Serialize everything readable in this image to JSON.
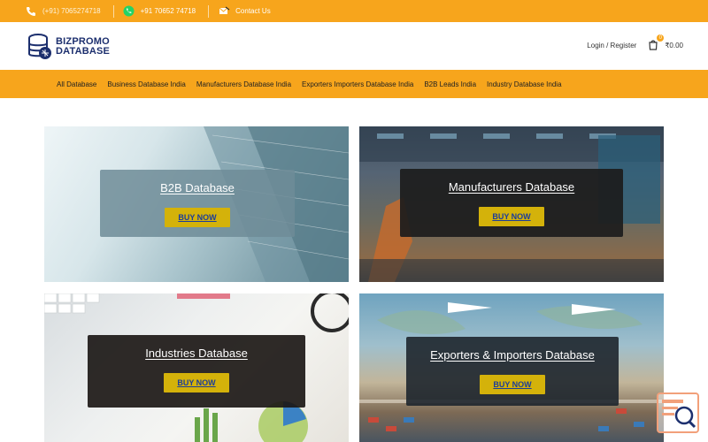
{
  "topbar": {
    "phone1": "(+91) 7065274718",
    "whatsapp": "+91 70652 74718",
    "contact": "Contact Us"
  },
  "header": {
    "logo_line1": "BIZPROMO",
    "logo_line2": "DATABASE",
    "login_register": "Login / Register",
    "cart_count": "0",
    "cart_total": "₹0.00"
  },
  "nav": {
    "items": [
      "All Database",
      "Business Database India",
      "Manufacturers Database India",
      "Exporters Importers Database India",
      "B2B Leads India",
      "Industry Database India"
    ]
  },
  "cards": [
    {
      "title": "B2B Database",
      "button": "BUY NOW"
    },
    {
      "title": "Manufacturers Database",
      "button": "BUY NOW"
    },
    {
      "title": "Industries Database",
      "button": "BUY NOW"
    },
    {
      "title": "Exporters & Importers Database",
      "button": "BUY NOW"
    }
  ],
  "colors": {
    "accent": "#f7a51c",
    "button": "#d4b20a",
    "brand": "#1c2f6e"
  },
  "icons": {
    "phone": "phone-icon",
    "whatsapp": "whatsapp-icon",
    "contact": "contact-icon",
    "cart": "cart-icon",
    "search_doc": "search-document-icon"
  }
}
